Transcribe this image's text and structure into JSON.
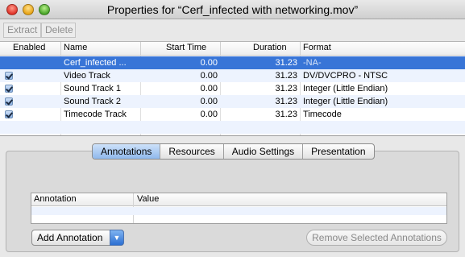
{
  "window": {
    "title": "Properties for “Cerf_infected with networking.mov”"
  },
  "toolbar": {
    "extract_label": "Extract",
    "delete_label": "Delete"
  },
  "tracks": {
    "columns": [
      "Enabled",
      "Name",
      "Start Time",
      "Duration",
      "Format"
    ],
    "rows": [
      {
        "enabled": false,
        "name": "Cerf_infected ...",
        "start": "0.00",
        "duration": "31.23",
        "format": "-NA-",
        "selected": true
      },
      {
        "enabled": true,
        "name": "Video Track",
        "start": "0.00",
        "duration": "31.23",
        "format": "DV/DVCPRO - NTSC",
        "selected": false
      },
      {
        "enabled": true,
        "name": "Sound Track 1",
        "start": "0.00",
        "duration": "31.23",
        "format": "Integer (Little Endian)",
        "selected": false
      },
      {
        "enabled": true,
        "name": "Sound Track 2",
        "start": "0.00",
        "duration": "31.23",
        "format": "Integer (Little Endian)",
        "selected": false
      },
      {
        "enabled": true,
        "name": "Timecode Track",
        "start": "0.00",
        "duration": "31.23",
        "format": "Timecode",
        "selected": false
      }
    ]
  },
  "tabs": [
    {
      "label": "Annotations",
      "active": true
    },
    {
      "label": "Resources",
      "active": false
    },
    {
      "label": "Audio Settings",
      "active": false
    },
    {
      "label": "Presentation",
      "active": false
    }
  ],
  "annotations": {
    "columns": [
      "Annotation",
      "Value"
    ],
    "add_label": "Add Annotation",
    "remove_label": "Remove Selected Annotations"
  },
  "colors": {
    "selection": "#3875d7",
    "alternate_row": "#edf3fe"
  }
}
